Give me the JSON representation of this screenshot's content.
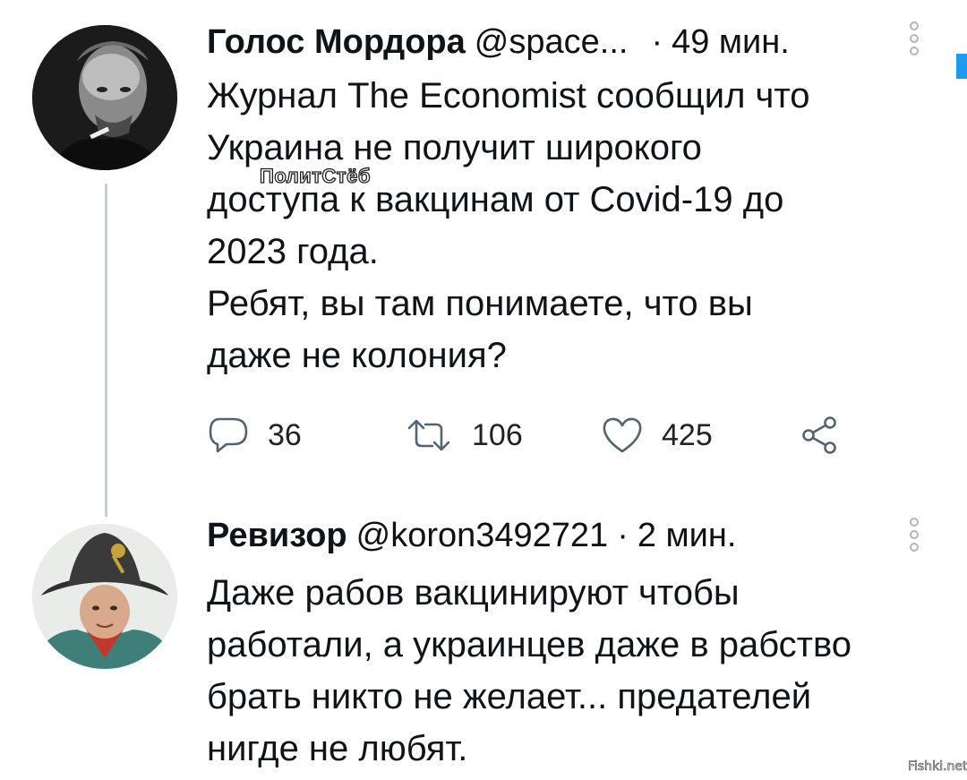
{
  "tweets": [
    {
      "author": "Голос Мордора",
      "handle": "@space...",
      "separator": "·",
      "time": "49 мин.",
      "text": "Журнал The Economist сообщил что\nУкраина не получит широкого\nдоступа к вакцинам от Covid-19 до\n2023 года.\nРебят, вы там понимаете, что вы\nдаже не колония?",
      "replies": "36",
      "retweets": "106",
      "likes": "425"
    },
    {
      "author": "Ревизор",
      "handle": "@koron3492721",
      "separator": "·",
      "time": "2 мин.",
      "text": "Даже рабов вакцинируют чтобы\nработали, а украинцев даже в рабство\nбрать никто не желает... предателей\nнигде не любят."
    }
  ],
  "watermark": "ПолитСтёб",
  "corner_mark": "Fishki.net",
  "icons": [
    "reply-icon",
    "retweet-icon",
    "like-icon",
    "share-icon",
    "more-icon"
  ],
  "colors": {
    "text": "#0f1419",
    "thread_line": "#c4cfd6",
    "accent": "#1d9bf0",
    "icon": "#536471"
  }
}
